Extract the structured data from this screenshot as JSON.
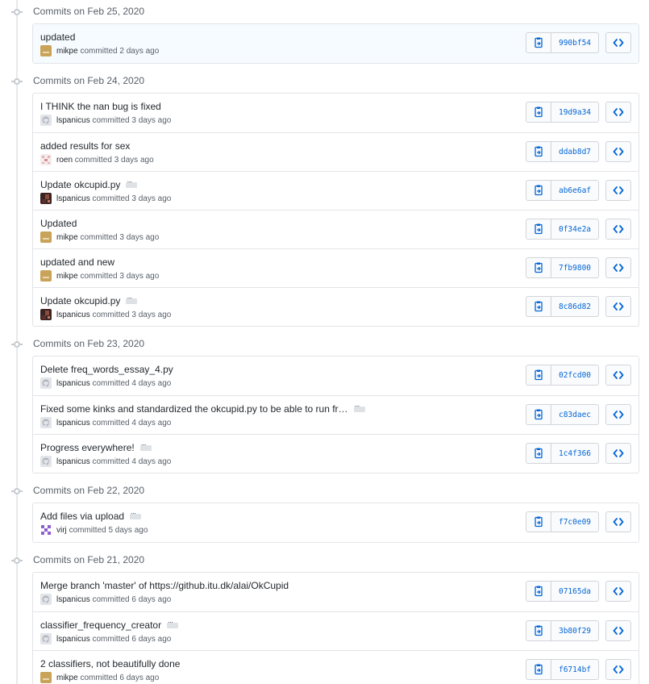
{
  "groups": [
    {
      "title": "Commits on Feb 25, 2020",
      "commits": [
        {
          "message": "updated",
          "author": "mikpe",
          "committed_text": "committed 2 days ago",
          "sha": "990bf54",
          "ellipsis": false,
          "avatar": "mikpe-avatar",
          "highlight": true
        }
      ]
    },
    {
      "title": "Commits on Feb 24, 2020",
      "commits": [
        {
          "message": "I THINK the nan bug is fixed",
          "author": "lspanicus",
          "committed_text": "committed 3 days ago",
          "sha": "19d9a34",
          "ellipsis": false,
          "avatar": "default-avatar"
        },
        {
          "message": "added results for sex",
          "author": "roen",
          "committed_text": "committed 3 days ago",
          "sha": "ddab8d7",
          "ellipsis": false,
          "avatar": "roen-avatar"
        },
        {
          "message": "Update okcupid.py",
          "author": "lspanicus",
          "committed_text": "committed 3 days ago",
          "sha": "ab6e6af",
          "ellipsis": true,
          "avatar": "photo-avatar"
        },
        {
          "message": "Updated",
          "author": "mikpe",
          "committed_text": "committed 3 days ago",
          "sha": "0f34e2a",
          "ellipsis": false,
          "avatar": "mikpe-avatar"
        },
        {
          "message": "updated and new",
          "author": "mikpe",
          "committed_text": "committed 3 days ago",
          "sha": "7fb9800",
          "ellipsis": false,
          "avatar": "mikpe-avatar"
        },
        {
          "message": "Update okcupid.py",
          "author": "lspanicus",
          "committed_text": "committed 3 days ago",
          "sha": "8c86d82",
          "ellipsis": true,
          "avatar": "photo-avatar"
        }
      ]
    },
    {
      "title": "Commits on Feb 23, 2020",
      "commits": [
        {
          "message": "Delete freq_words_essay_4.py",
          "author": "lspanicus",
          "committed_text": "committed 4 days ago",
          "sha": "02fcd00",
          "ellipsis": false,
          "avatar": "default-avatar"
        },
        {
          "message": "Fixed some kinks and standardized the okcupid.py to be able to run fr…",
          "author": "lspanicus",
          "committed_text": "committed 4 days ago",
          "sha": "c83daec",
          "ellipsis": true,
          "avatar": "default-avatar"
        },
        {
          "message": "Progress everywhere!",
          "author": "lspanicus",
          "committed_text": "committed 4 days ago",
          "sha": "1c4f366",
          "ellipsis": true,
          "avatar": "default-avatar"
        }
      ]
    },
    {
      "title": "Commits on Feb 22, 2020",
      "commits": [
        {
          "message": "Add files via upload",
          "author": "virj",
          "committed_text": "committed 5 days ago",
          "sha": "f7c0e09",
          "ellipsis": true,
          "avatar": "virj-avatar"
        }
      ]
    },
    {
      "title": "Commits on Feb 21, 2020",
      "commits": [
        {
          "message": "Merge branch 'master' of https://github.itu.dk/alai/OkCupid",
          "author": "lspanicus",
          "committed_text": "committed 6 days ago",
          "sha": "07165da",
          "ellipsis": false,
          "avatar": "default-avatar"
        },
        {
          "message": "classifier_frequency_creator",
          "author": "lspanicus",
          "committed_text": "committed 6 days ago",
          "sha": "3b80f29",
          "ellipsis": true,
          "avatar": "default-avatar"
        },
        {
          "message": "2 classifiers, not beautifully done",
          "author": "mikpe",
          "committed_text": "committed 6 days ago",
          "sha": "f6714bf",
          "ellipsis": false,
          "avatar": "mikpe-avatar"
        }
      ]
    }
  ],
  "icons": {
    "copy": "clippy-icon",
    "browse": "code-icon",
    "timeline_node": "git-commit-icon"
  },
  "colors": {
    "sha_link": "#0366d6",
    "border": "#e1e4e8",
    "highlight_row": "#f6fbff",
    "muted_text": "#586069"
  }
}
